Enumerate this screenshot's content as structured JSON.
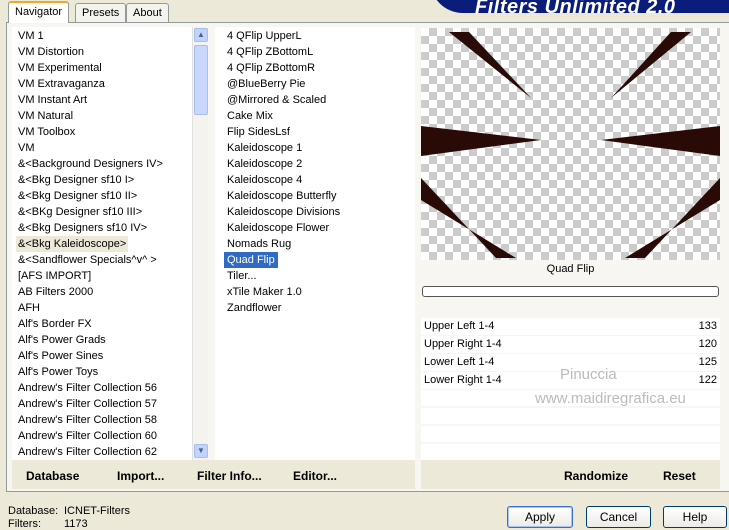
{
  "tabs": [
    {
      "label": "Navigator",
      "active": true
    },
    {
      "label": "Presets"
    },
    {
      "label": "About"
    }
  ],
  "banner": "Filters Unlimited 2.0",
  "categories": [
    "VM 1",
    "VM Distortion",
    "VM Experimental",
    "VM Extravaganza",
    "VM Instant Art",
    "VM Natural",
    "VM Toolbox",
    "VM",
    "&<Background Designers IV>",
    "&<Bkg Designer sf10 I>",
    "&<Bkg Designer sf10 II>",
    "&<BKg Designer sf10 III>",
    "&<Bkg Designers sf10 IV>",
    "&<Bkg Kaleidoscope>",
    "&<Sandflower Specials^v^ >",
    "[AFS IMPORT]",
    "AB Filters 2000",
    "AFH",
    "Alf's Border FX",
    "Alf's Power Grads",
    "Alf's Power Sines",
    "Alf's Power Toys",
    "Andrew's Filter Collection 56",
    "Andrew's Filter Collection 57",
    "Andrew's Filter Collection 58",
    "Andrew's Filter Collection 60",
    "Andrew's Filter Collection 62"
  ],
  "selected_category": "&<Bkg Kaleidoscope>",
  "filters": [
    "4 QFlip UpperL",
    "4 QFlip ZBottomL",
    "4 QFlip ZBottomR",
    "@BlueBerry Pie",
    "@Mirrored & Scaled",
    "Cake Mix",
    "Flip SidesLsf",
    "Kaleidoscope 1",
    "Kaleidoscope 2",
    "Kaleidoscope 4",
    "Kaleidoscope Butterfly",
    "Kaleidoscope Divisions",
    "Kaleidoscope Flower",
    "Nomads Rug",
    "Quad Flip",
    "Tiler...",
    "xTile Maker 1.0",
    "Zandflower"
  ],
  "selected_filter": "Quad Flip",
  "preview": {
    "shape_color": "#2a0a06"
  },
  "filter_name": "Quad Flip",
  "progress": 0,
  "sliders": [
    {
      "label": "Upper Left 1-4",
      "value": "133"
    },
    {
      "label": "Upper Right 1-4",
      "value": "120"
    },
    {
      "label": "Lower Left 1-4",
      "value": "125"
    },
    {
      "label": "Lower Right 1-4",
      "value": "122"
    }
  ],
  "watermark": {
    "line1": "Pinuccia",
    "line2": "www.maidiregrafica.eu"
  },
  "buttons": {
    "database": "Database",
    "import": "Import...",
    "filter_info": "Filter Info...",
    "editor": "Editor...",
    "randomize": "Randomize",
    "reset": "Reset",
    "apply": "Apply",
    "cancel": "Cancel",
    "help": "Help"
  },
  "status": {
    "database_label": "Database:",
    "database_value": "ICNET-Filters",
    "filters_label": "Filters:",
    "filters_value": "1173"
  }
}
